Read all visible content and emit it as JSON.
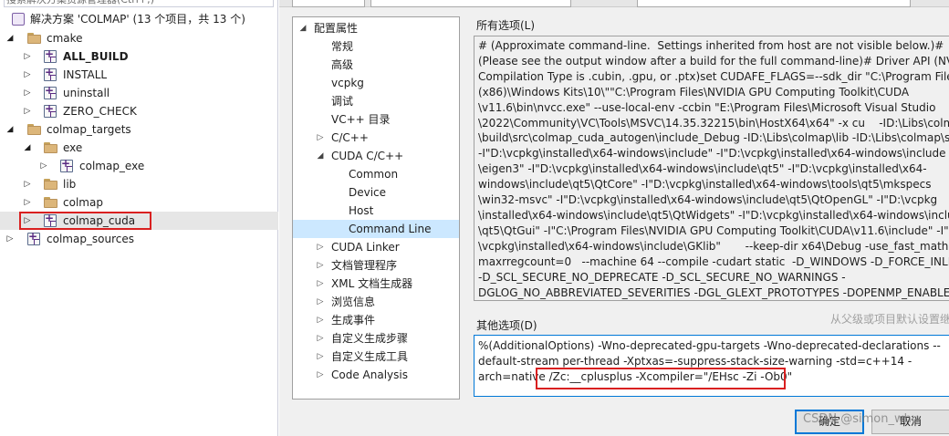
{
  "solution_explorer": {
    "search_placeholder": "搜索解决方案资源管理器(Ctrl+;)",
    "solution_label": "解决方案 'COLMAP' (13 个项目，共 13 个)",
    "items": [
      {
        "label": "cmake",
        "kind": "folder"
      },
      {
        "label": "ALL_BUILD",
        "kind": "project"
      },
      {
        "label": "INSTALL",
        "kind": "project"
      },
      {
        "label": "uninstall",
        "kind": "project"
      },
      {
        "label": "ZERO_CHECK",
        "kind": "project"
      },
      {
        "label": "colmap_targets",
        "kind": "folder"
      },
      {
        "label": "exe",
        "kind": "folder"
      },
      {
        "label": "colmap_exe",
        "kind": "project"
      },
      {
        "label": "lib",
        "kind": "folder"
      },
      {
        "label": "colmap",
        "kind": "folder"
      },
      {
        "label": "colmap_cuda",
        "kind": "project"
      },
      {
        "label": "colmap_sources",
        "kind": "project"
      }
    ]
  },
  "config_tree": {
    "items": [
      {
        "label": "配置属性"
      },
      {
        "label": "常规"
      },
      {
        "label": "高级"
      },
      {
        "label": "vcpkg"
      },
      {
        "label": "调试"
      },
      {
        "label": "VC++ 目录"
      },
      {
        "label": "C/C++"
      },
      {
        "label": "CUDA C/C++"
      },
      {
        "label": "Common"
      },
      {
        "label": "Device"
      },
      {
        "label": "Host"
      },
      {
        "label": "Command Line"
      },
      {
        "label": "CUDA Linker"
      },
      {
        "label": "文档管理程序"
      },
      {
        "label": "XML 文档生成器"
      },
      {
        "label": "浏览信息"
      },
      {
        "label": "生成事件"
      },
      {
        "label": "自定义生成步骤"
      },
      {
        "label": "自定义生成工具"
      },
      {
        "label": "Code Analysis"
      }
    ]
  },
  "all_options": {
    "label": "所有选项(L)",
    "lines": [
      "# (Approximate command-line.  Settings inherited from host are not visible below.)#",
      "(Please see the output window after a build for the full command-line)# Driver API (NVCC",
      "Compilation Type is .cubin, .gpu, or .ptx)set CUDAFE_FLAGS=--sdk_dir \"C:\\Program Files",
      "(x86)\\Windows Kits\\10\\\"\"C:\\Program Files\\NVIDIA GPU Computing Toolkit\\CUDA",
      "\\v11.6\\bin\\nvcc.exe\" --use-local-env -ccbin \"E:\\Program Files\\Microsoft Visual Studio",
      "\\2022\\Community\\VC\\Tools\\MSVC\\14.35.32215\\bin\\HostX64\\x64\" -x cu    -ID:\\Libs\\colma",
      "\\build\\src\\colmap_cuda_autogen\\include_Debug -ID:\\Libs\\colmap\\lib -ID:\\Libs\\colmap\\sr",
      "-I\"D:\\vcpkg\\installed\\x64-windows\\include\" -I\"D:\\vcpkg\\installed\\x64-windows\\include",
      "\\eigen3\" -I\"D:\\vcpkg\\installed\\x64-windows\\include\\qt5\" -I\"D:\\vcpkg\\installed\\x64-",
      "windows\\include\\qt5\\QtCore\" -I\"D:\\vcpkg\\installed\\x64-windows\\tools\\qt5\\mkspecs",
      "\\win32-msvc\" -I\"D:\\vcpkg\\installed\\x64-windows\\include\\qt5\\QtOpenGL\" -I\"D:\\vcpkg",
      "\\installed\\x64-windows\\include\\qt5\\QtWidgets\" -I\"D:\\vcpkg\\installed\\x64-windows\\includ",
      "\\qt5\\QtGui\" -I\"C:\\Program Files\\NVIDIA GPU Computing Toolkit\\CUDA\\v11.6\\include\" -I\"D",
      "\\vcpkg\\installed\\x64-windows\\include\\GKlib\"       --keep-dir x64\\Debug -use_fast_math -",
      "maxrregcount=0   --machine 64 --compile -cudart static  -D_WINDOWS -D_FORCE_INLINE",
      "-D_SCL_SECURE_NO_DEPRECATE -D_SCL_SECURE_NO_WARNINGS -",
      "DGLOG_NO_ABBREVIATED_SEVERITIES -DGL_GLEXT_PROTOTYPES -DOPENMP_ENABLED"
    ]
  },
  "other_options": {
    "label": "其他选项(D)",
    "inherit_text": "从父级或项目默认设置继",
    "line1": "%(AdditionalOptions) -Wno-deprecated-gpu-targets -Wno-deprecated-declarations --",
    "line2": "default-stream per-thread -Xptxas=-suppress-stack-size-warning -std=c++14 -",
    "line3": "arch=native /Zc:__cplusplus -Xcompiler=\"/EHsc -Zi -Ob0\""
  },
  "buttons": {
    "ok": "确定",
    "cancel": "取消"
  },
  "watermark": "CSDN @simon_whu"
}
